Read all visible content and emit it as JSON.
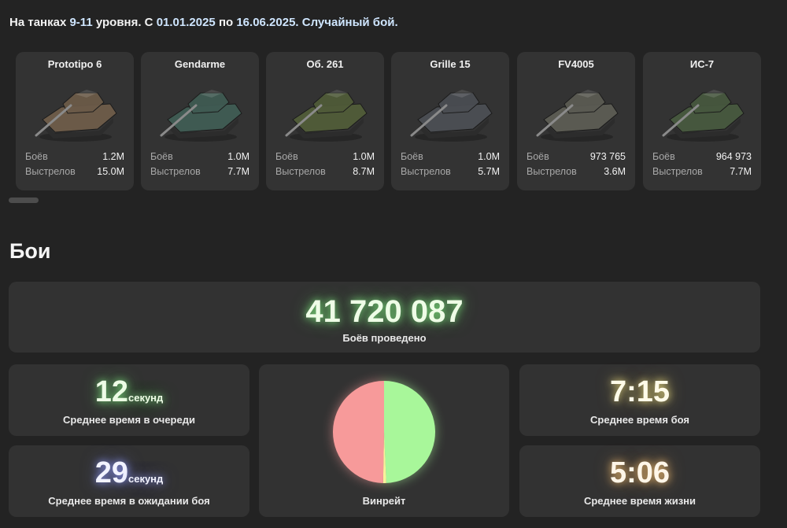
{
  "header": {
    "prefix": "На танках",
    "levels": "9-11",
    "mid1": "уровня. С",
    "date_from": "01.01.2025",
    "mid2": "по",
    "date_to": "16.06.2025.",
    "battle_type": "Случайный бой."
  },
  "tanks": [
    {
      "name": "Prototipo 6",
      "battles_label": "Боёв",
      "battles": "1.2M",
      "shots_label": "Выстрелов",
      "shots": "15.0M",
      "color": "#6b5a48"
    },
    {
      "name": "Gendarme",
      "battles_label": "Боёв",
      "battles": "1.0M",
      "shots_label": "Выстрелов",
      "shots": "7.7M",
      "color": "#3f5a52"
    },
    {
      "name": "Об. 261",
      "battles_label": "Боёв",
      "battles": "1.0M",
      "shots_label": "Выстрелов",
      "shots": "8.7M",
      "color": "#4f5a38"
    },
    {
      "name": "Grille 15",
      "battles_label": "Боёв",
      "battles": "1.0M",
      "shots_label": "Выстрелов",
      "shots": "5.7M",
      "color": "#4a4d52"
    },
    {
      "name": "FV4005",
      "battles_label": "Боёв",
      "battles": "973 765",
      "shots_label": "Выстрелов",
      "shots": "3.6M",
      "color": "#5a5a52"
    },
    {
      "name": "ИС-7",
      "battles_label": "Боёв",
      "battles": "964 973",
      "shots_label": "Выстрелов",
      "shots": "7.7M",
      "color": "#46573e"
    }
  ],
  "section_title": "Бои",
  "total_battles": {
    "value": "41 720 087",
    "caption": "Боёв проведено"
  },
  "queue_time": {
    "value": "12",
    "unit": "секунд",
    "caption": "Среднее время в очереди"
  },
  "wait_time": {
    "value": "29",
    "unit": "секунд",
    "caption": "Среднее время в ожидании боя"
  },
  "winrate": {
    "caption": "Винрейт",
    "chart_data": {
      "type": "pie",
      "slices": [
        {
          "value": 49.3,
          "color": "#a8f79a"
        },
        {
          "value": 1.0,
          "color": "#f7f29a"
        },
        {
          "value": 49.7,
          "color": "#f79a9a"
        }
      ]
    }
  },
  "battle_time": {
    "value": "7:15",
    "caption": "Среднее время боя"
  },
  "life_time": {
    "value": "5:06",
    "caption": "Среднее время жизни"
  }
}
